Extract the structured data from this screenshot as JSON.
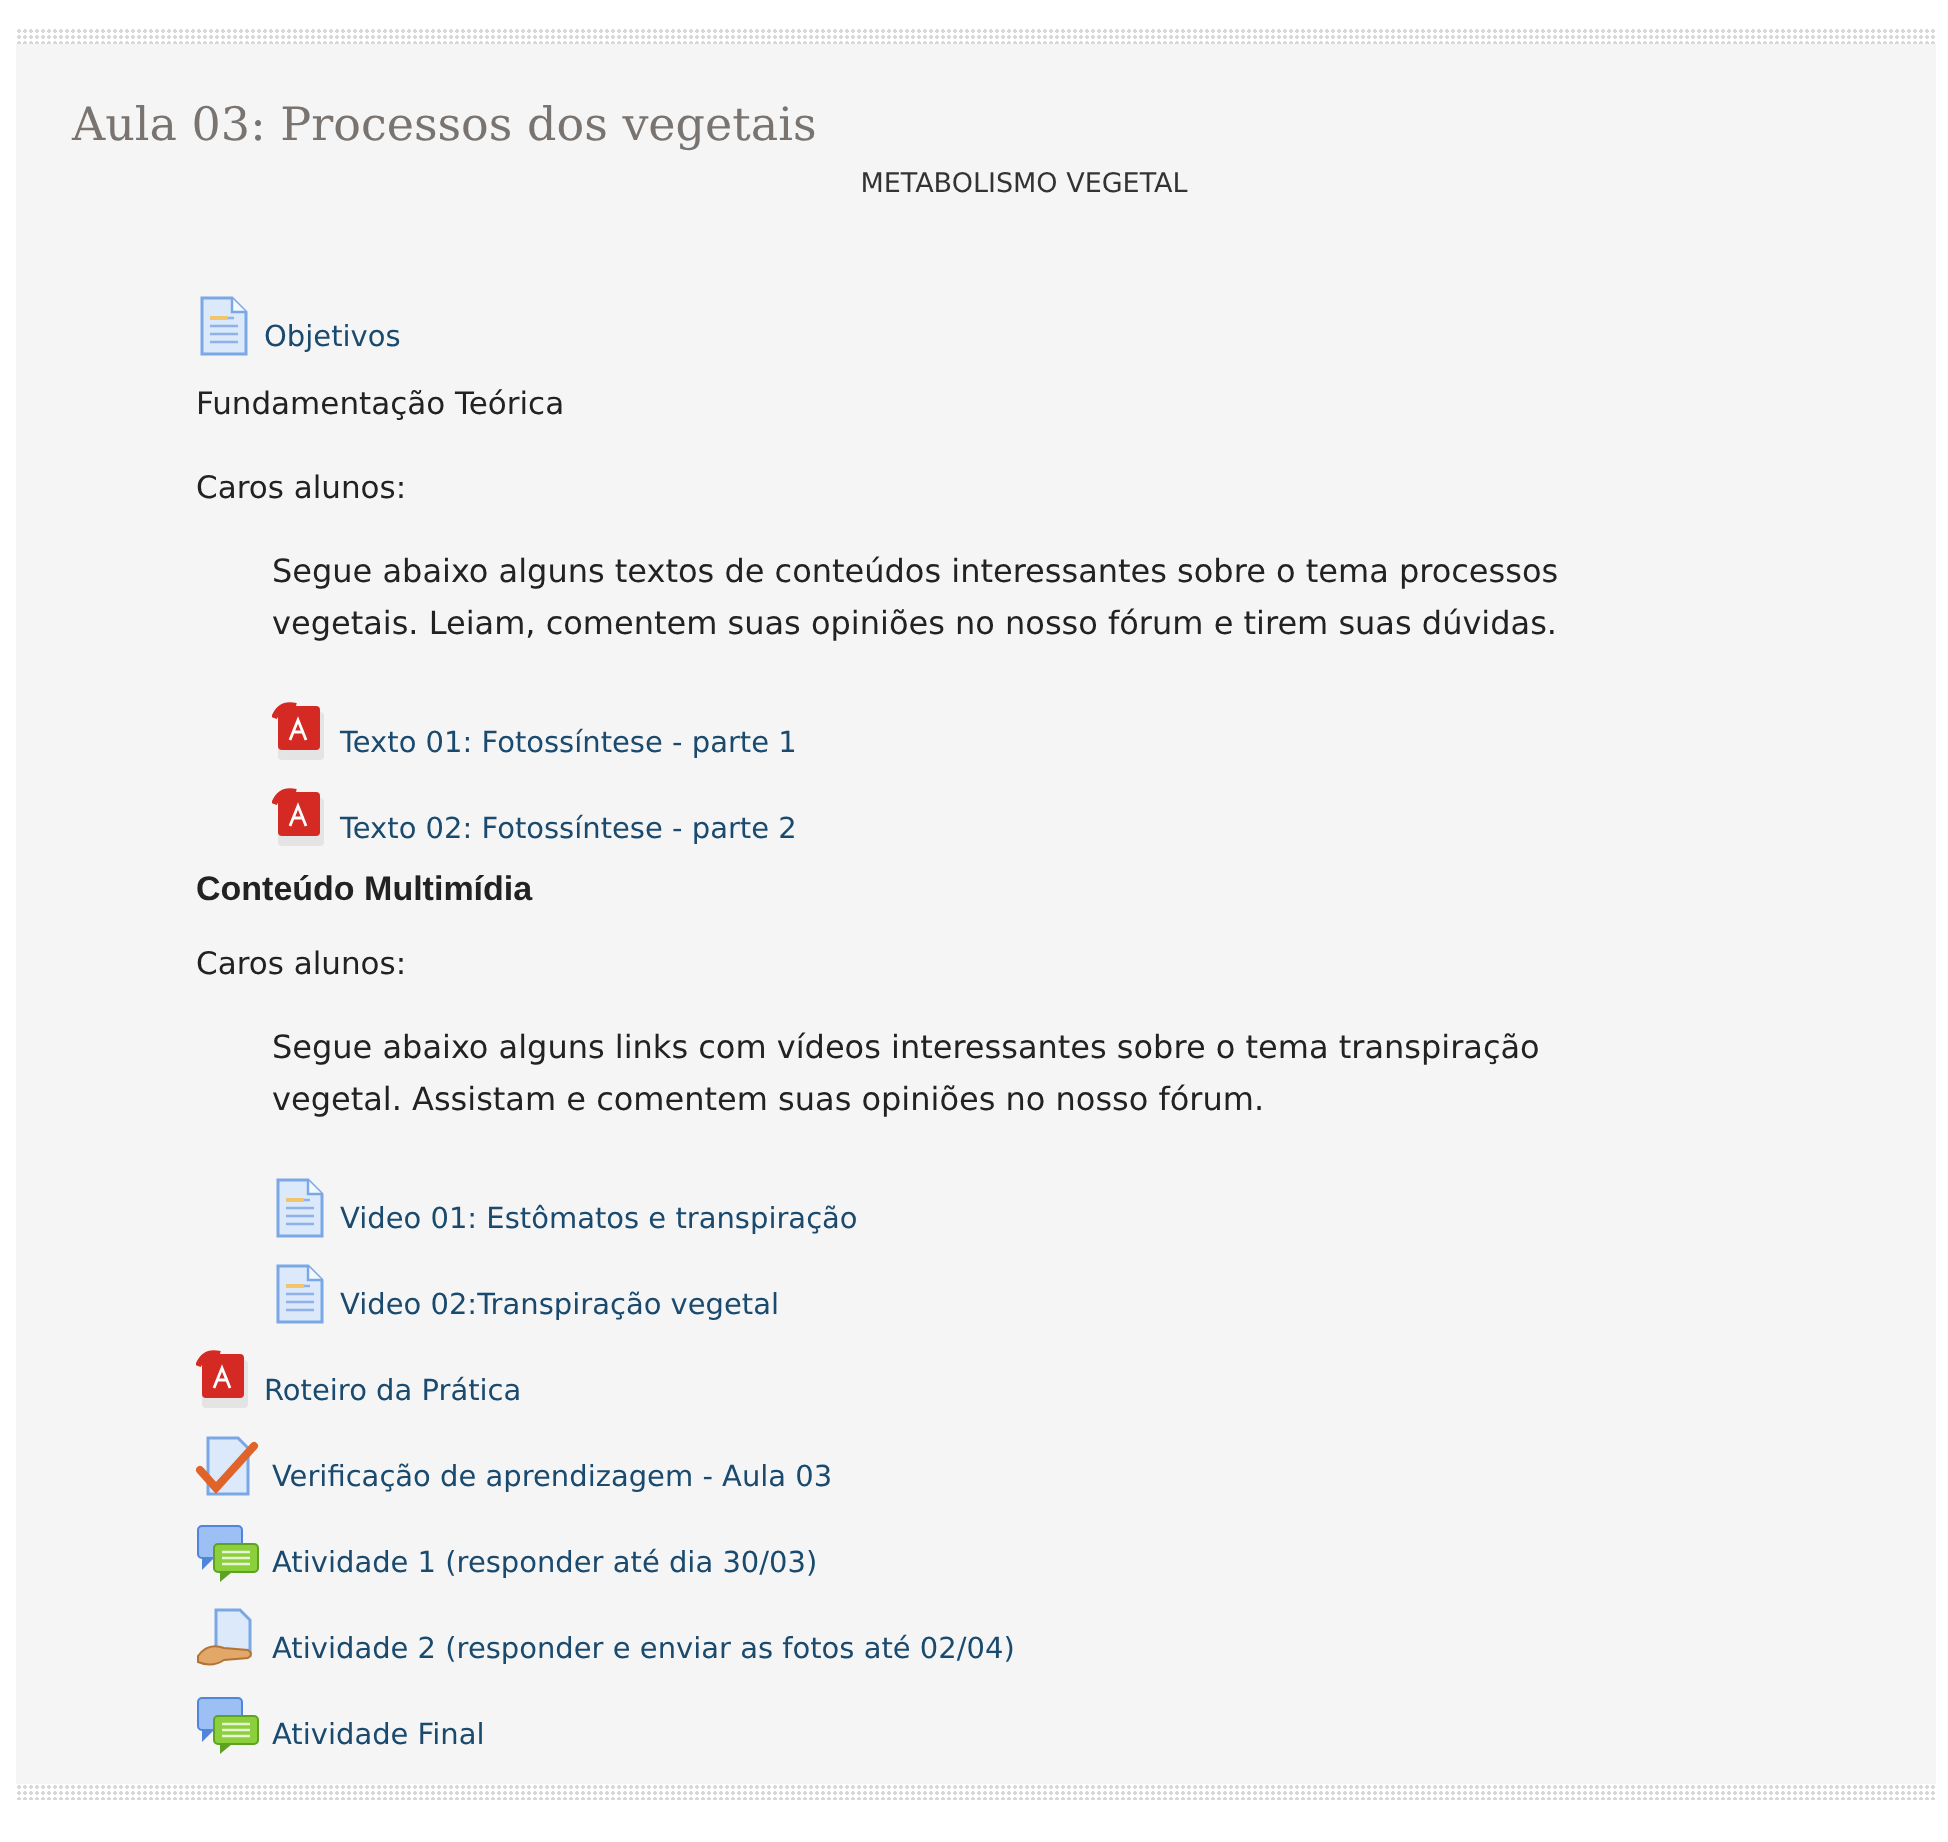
{
  "section": {
    "title": "Aula 03: Processos dos vegetais",
    "subtitle": "METABOLISMO VEGETAL",
    "items": [
      {
        "kind": "page",
        "text": "Objetivos"
      },
      {
        "kind": "label",
        "text": "Fundamentação Teórica"
      },
      {
        "kind": "label",
        "text": "Caros alunos:",
        "children": [
          {
            "kind": "paragraph",
            "text": "Segue abaixo alguns textos de conteúdos interessantes sobre o tema processos vegetais. Leiam, comentem suas opiniões no nosso fórum e tirem suas dúvidas."
          },
          {
            "kind": "pdf",
            "text": "Texto 01: Fotossíntese - parte 1"
          },
          {
            "kind": "pdf",
            "text": "Texto 02: Fotossíntese - parte 2"
          }
        ]
      },
      {
        "kind": "heading",
        "text": "Conteúdo Multimídia"
      },
      {
        "kind": "label",
        "text": "Caros alunos:",
        "children": [
          {
            "kind": "paragraph",
            "text": "Segue abaixo alguns links com vídeos interessantes sobre o tema transpiração vegetal. Assistam e comentem suas opiniões no nosso fórum."
          },
          {
            "kind": "page",
            "text": "Video 01: Estômatos e transpiração"
          },
          {
            "kind": "page",
            "text": "Video 02:Transpiração vegetal"
          }
        ]
      },
      {
        "kind": "pdf",
        "text": "Roteiro da Prática"
      },
      {
        "kind": "quiz",
        "text": "Verificação de aprendizagem - Aula 03"
      },
      {
        "kind": "forum",
        "text": "Atividade 1 (responder até dia 30/03)"
      },
      {
        "kind": "assignment",
        "text": "Atividade 2 (responder e enviar as fotos até 02/04)"
      },
      {
        "kind": "forum",
        "text": "Atividade Final"
      }
    ]
  }
}
